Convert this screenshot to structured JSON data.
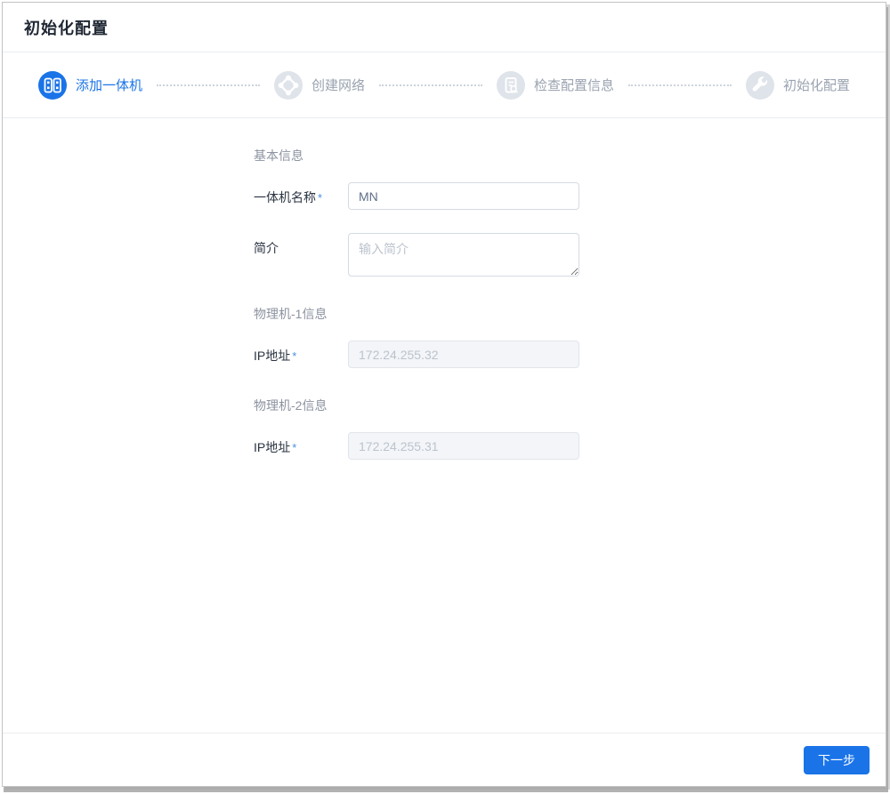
{
  "page": {
    "title": "初始化配置"
  },
  "steps": [
    {
      "label": "添加一体机",
      "icon": "server-icon",
      "state": "active"
    },
    {
      "label": "创建网络",
      "icon": "network-icon",
      "state": "pending"
    },
    {
      "label": "检查配置信息",
      "icon": "doc-search-icon",
      "state": "pending"
    },
    {
      "label": "初始化配置",
      "icon": "wrench-icon",
      "state": "pending"
    }
  ],
  "form": {
    "required_mark": "*",
    "section_basic": "基本信息",
    "name_label": "一体机名称",
    "name_value": "MN",
    "intro_label": "简介",
    "intro_placeholder": "输入简介",
    "section_host1": "物理机-1信息",
    "section_host2": "物理机-2信息",
    "ip_label": "IP地址",
    "host1_ip": "172.24.255.32",
    "host2_ip": "172.24.255.31"
  },
  "footer": {
    "next_label": "下一步"
  },
  "colors": {
    "primary_blue": "#1a74e8",
    "pending_gray": "#dfe3ea",
    "pending_text": "#9aa3b0",
    "required_mark": "#4a90e2",
    "disabled_bg": "#f3f5f8"
  }
}
